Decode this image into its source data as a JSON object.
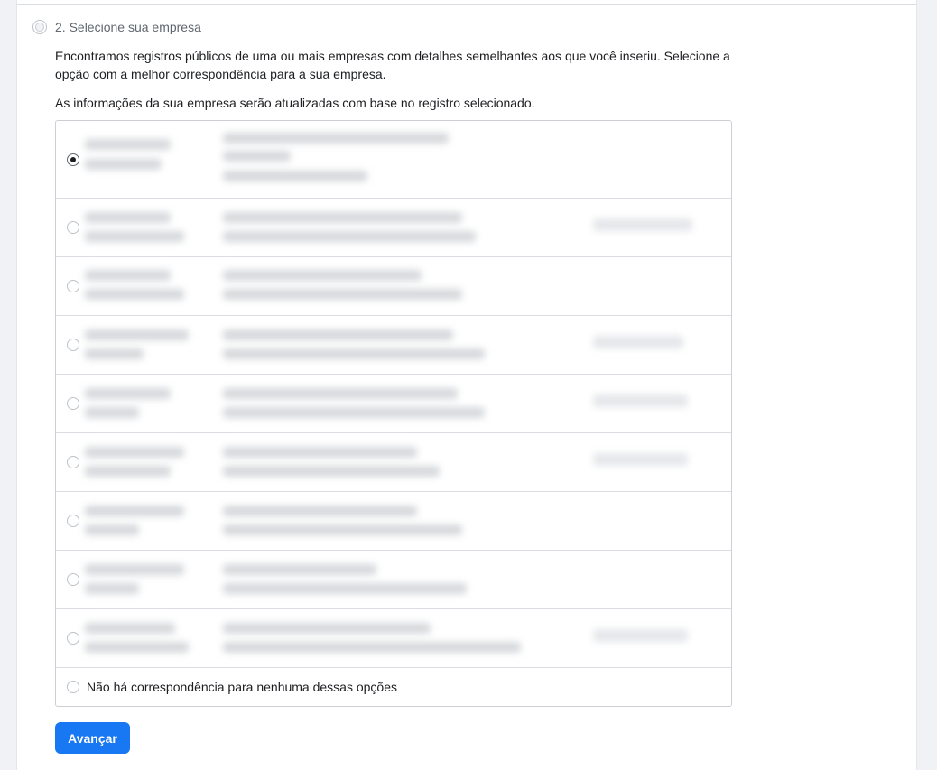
{
  "step": {
    "title": "2. Selecione sua empresa",
    "description": "Encontramos registros públicos de uma ou mais empresas com detalhes semelhantes aos que você inseriu. Selecione a opção com a melhor correspondência para a sua empresa.",
    "note": "As informações da sua empresa serão atualizadas com base no registro selecionado."
  },
  "options": {
    "records_count": 9,
    "selected_index": 0,
    "no_match_label": "Não há correspondência para nenhuma dessas opções"
  },
  "actions": {
    "next_label": "Avançar"
  },
  "colors": {
    "primary": "#1877f2",
    "text": "#1c1e21",
    "muted": "#606770",
    "border": "#ccd0d5"
  }
}
